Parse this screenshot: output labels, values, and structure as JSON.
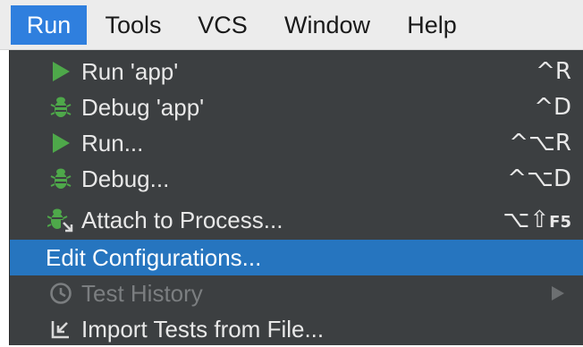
{
  "menubar": {
    "items": [
      {
        "label": "Run",
        "active": true
      },
      {
        "label": "Tools"
      },
      {
        "label": "VCS"
      },
      {
        "label": "Window"
      },
      {
        "label": "Help"
      }
    ]
  },
  "menu": {
    "items": [
      {
        "label": "Run 'app'",
        "shortcut": "^R",
        "icon": "run-icon"
      },
      {
        "label": "Debug 'app'",
        "shortcut": "^D",
        "icon": "debug-icon"
      },
      {
        "label": "Run...",
        "shortcut": "^⌥R",
        "icon": "run-icon"
      },
      {
        "label": "Debug...",
        "shortcut": "^⌥D",
        "icon": "debug-icon"
      },
      {
        "label": "Attach to Process...",
        "shortcut_symbols": "⌥⇧",
        "shortcut_key": "F5",
        "icon": "attach-debugger-icon"
      },
      {
        "label": "Edit Configurations...",
        "selected": true
      },
      {
        "label": "Test History",
        "disabled": true,
        "icon": "history-clock-icon",
        "submenu": true
      },
      {
        "label": "Import Tests from File...",
        "icon": "import-icon"
      }
    ]
  },
  "colors": {
    "menubar_bg": "#ececec",
    "active_menu": "#2f7fde",
    "menu_bg": "#3c3f41",
    "selection": "#2675bf",
    "run_green": "#4ea84a",
    "disabled_text": "#7b7e80"
  }
}
